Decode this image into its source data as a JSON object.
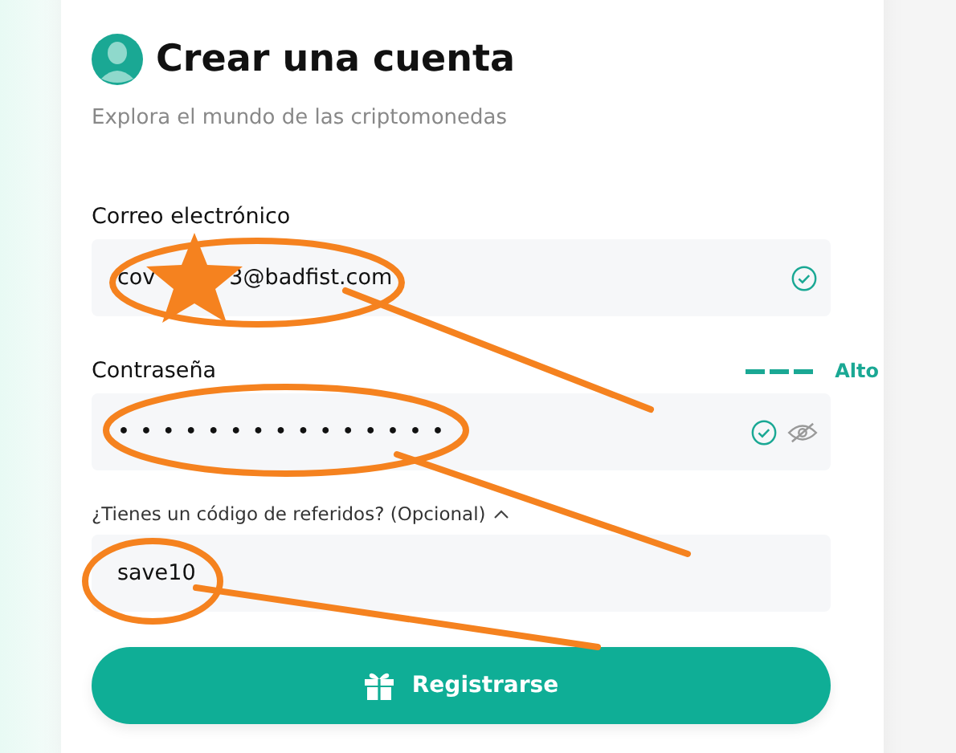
{
  "header": {
    "title": "Crear una cuenta",
    "subtitle": "Explora el mundo de las criptomonedas"
  },
  "email": {
    "label": "Correo electrónico",
    "value_start": "cov",
    "value_end": "3@badfist.com",
    "valid": true
  },
  "password": {
    "label": "Contraseña",
    "strength_label": "Alto",
    "level": 1,
    "value": "•••••••••••••••",
    "valid": true
  },
  "referral": {
    "label": "¿Tienes un código de referidos? (Opcional)",
    "expanded": true,
    "value": "save10"
  },
  "submit": {
    "label": "Registrarse"
  },
  "annotation_overlay": {
    "shown": true
  }
}
